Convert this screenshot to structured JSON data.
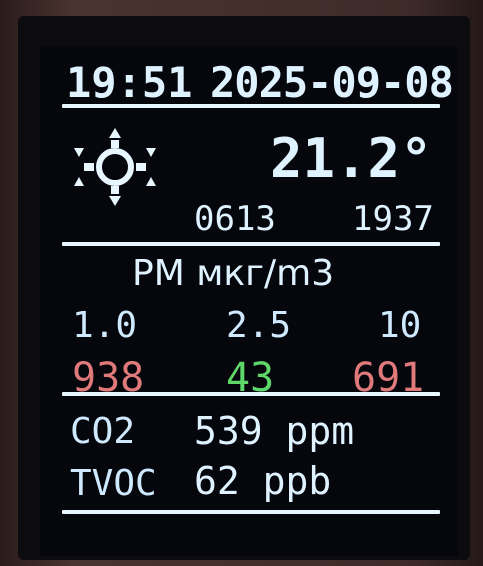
{
  "header": {
    "time": "19:51",
    "date": "2025-09-08"
  },
  "weather": {
    "icon": "sun-icon",
    "temperature": "21.2°",
    "sunrise": "0613",
    "sunset": "1937"
  },
  "pm": {
    "title": "PM мкг/m3",
    "columns": [
      {
        "label": "1.0",
        "value": "938",
        "color": "#e07a7a"
      },
      {
        "label": "2.5",
        "value": "43",
        "color": "#5fd86a"
      },
      {
        "label": "10",
        "value": "691",
        "color": "#e07a7a"
      }
    ]
  },
  "air": {
    "co2_label": "CO2",
    "co2_value": "539 ppm",
    "tvoc_label": "TVOC",
    "tvoc_value": "62 ppb"
  }
}
